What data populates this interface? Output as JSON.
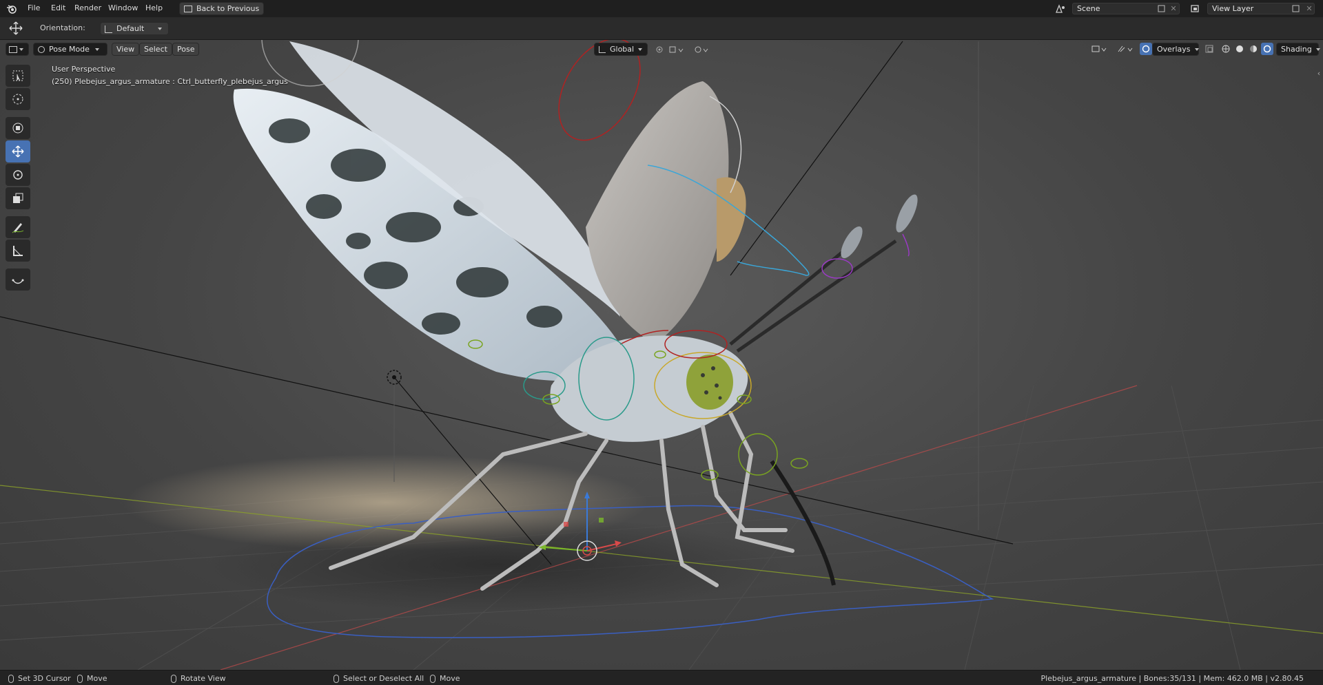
{
  "topbar": {
    "menus": [
      "File",
      "Edit",
      "Render",
      "Window",
      "Help"
    ],
    "back_button": "Back to Previous",
    "scene_field": "Scene",
    "view_layer_field": "View Layer"
  },
  "tool_options": {
    "orientation_label": "Orientation:",
    "orientation_value": "Default"
  },
  "viewport_header": {
    "mode": "Pose Mode",
    "menus": [
      "View",
      "Select",
      "Pose"
    ],
    "transform_orientation": "Global",
    "overlays_label": "Overlays",
    "shading_label": "Shading"
  },
  "viewport": {
    "perspective_label": "User Perspective",
    "object_label": "(250) Plebejus_argus_armature : Ctrl_butterfly_plebejus_argus"
  },
  "statusbar": {
    "items": [
      "Set 3D Cursor",
      "Move",
      "Rotate View",
      "Select or Deselect All",
      "Move"
    ],
    "info": "Plebejus_argus_armature | Bones:35/131 | Mem: 462.0 MB | v2.80.45"
  },
  "colors": {
    "accent": "#4772b3",
    "topbar_bg": "#1f1f1f",
    "viewport_bg": "#454545"
  }
}
